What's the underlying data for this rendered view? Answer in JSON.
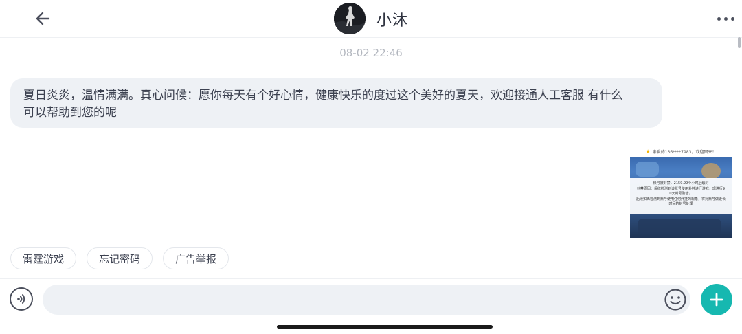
{
  "header": {
    "title": "小沐",
    "back_icon": "arrow-left-icon",
    "more_icon": "more-horizontal-icon"
  },
  "messages": {
    "timestamp": "08-02 22:46",
    "greeting_line1": "夏日炎炎，温情满满。真心问候：愿你每天有个好心情，健康快乐的度过这个美好的夏天，欢迎接通人工客服 有什么",
    "greeting_line2": "可以帮助到您的呢",
    "image": {
      "welcome": "亲爱的136****7983，欢迎回来！",
      "notice_line1": "账号被封禁，2159.99个小时后解封",
      "notice_line2": "封禁原因：系统检测到该账号使用外挂进行游戏，现进行9",
      "notice_line3": "0天封号警告。",
      "notice_line4": "后续如再检测到账号使用任何外挂的现象，将对账号做更长",
      "notice_line5": "时间的封号处理"
    }
  },
  "quick_replies": [
    {
      "label": "雷霆游戏"
    },
    {
      "label": "忘记密码"
    },
    {
      "label": "广告举报"
    }
  ],
  "input": {
    "placeholder": "",
    "voice_icon": "voice-icon",
    "emoji_icon": "emoji-icon",
    "plus_icon": "plus-icon"
  },
  "colors": {
    "accent": "#16b8b0",
    "bubble_bg": "#eef1f5",
    "text": "#3c4150",
    "timestamp": "#b3b7bf"
  }
}
